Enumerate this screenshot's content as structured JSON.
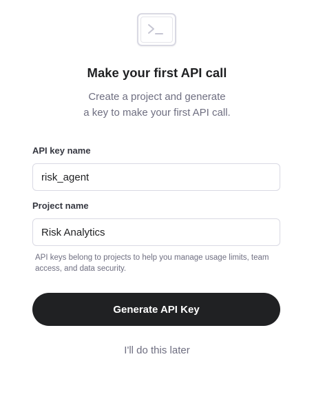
{
  "header": {
    "icon": "terminal-icon",
    "title": "Make your first API call",
    "subtitle_line1": "Create a project and generate",
    "subtitle_line2": "a key to make your first API call."
  },
  "form": {
    "api_key_name": {
      "label": "API key name",
      "value": "risk_agent"
    },
    "project_name": {
      "label": "Project name",
      "value": "Risk Analytics"
    },
    "help_text": "API keys belong to projects to help you manage usage limits, team access, and data security."
  },
  "actions": {
    "primary_label": "Generate API Key",
    "secondary_label": "I'll do this later"
  },
  "colors": {
    "primary_button": "#202123",
    "muted_text": "#6e6e80",
    "border": "#d9d9e3"
  }
}
